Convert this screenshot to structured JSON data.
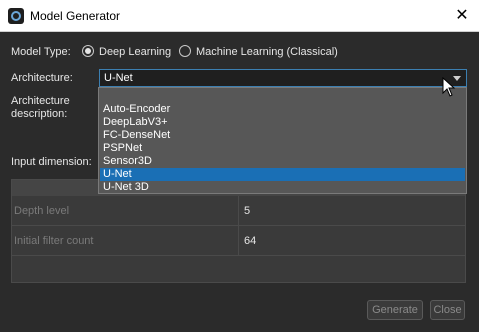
{
  "window": {
    "title": "Model Generator",
    "close_glyph": "✕"
  },
  "model_type": {
    "label": "Model Type:",
    "options": [
      "Deep Learning",
      "Machine Learning (Classical)"
    ],
    "selected": "Deep Learning"
  },
  "architecture": {
    "label": "Architecture:",
    "value": "U-Net",
    "description_label": "Architecture\ndescription:",
    "options": [
      "",
      "Auto-Encoder",
      "DeepLabV3+",
      "FC-DenseNet",
      "PSPNet",
      "Sensor3D",
      "U-Net",
      "U-Net 3D"
    ],
    "highlighted": "U-Net"
  },
  "input_dimension": {
    "label": "Input dimension:"
  },
  "parameters": {
    "rows": [
      {
        "name": "Depth level",
        "value": "5"
      },
      {
        "name": "Initial filter count",
        "value": "64"
      }
    ]
  },
  "buttons": {
    "generate": "Generate",
    "close": "Close"
  },
  "colors": {
    "accent": "#1a6fb5",
    "background": "#2b2b2b",
    "dropdown_bg": "#575757"
  },
  "icons": {
    "window_close": "close-icon",
    "dropdown": "chevron-down-icon",
    "app": "app-logo-icon",
    "cursor": "mouse-cursor-icon"
  }
}
